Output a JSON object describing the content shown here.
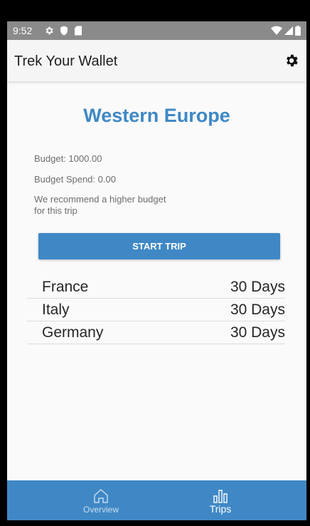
{
  "status_bar": {
    "time": "9:52",
    "icons_left": [
      "gear-icon",
      "shield-icon",
      "sd-card-icon"
    ],
    "icons_right": [
      "wifi-icon",
      "signal-icon",
      "battery-icon"
    ]
  },
  "app_bar": {
    "title": "Trek Your Wallet",
    "settings_icon": "gear-icon"
  },
  "trip": {
    "region": "Western Europe",
    "budget": "Budget: 1000.00",
    "budget_spend": "Budget Spend: 0.00",
    "recommendation": "We recommend a higher budget for this trip",
    "start_button": "START TRIP",
    "countries": [
      {
        "name": "France",
        "days": "30 Days"
      },
      {
        "name": "Italy",
        "days": "30 Days"
      },
      {
        "name": "Germany",
        "days": "30 Days"
      }
    ]
  },
  "bottom_nav": {
    "items": [
      {
        "label": "Overview",
        "icon": "home-icon",
        "active": false
      },
      {
        "label": "Trips",
        "icon": "bar-chart-icon",
        "active": true
      }
    ]
  },
  "colors": {
    "accent": "#3f88c5",
    "status_bar": "#8a8a8a",
    "background": "#fafafa"
  }
}
